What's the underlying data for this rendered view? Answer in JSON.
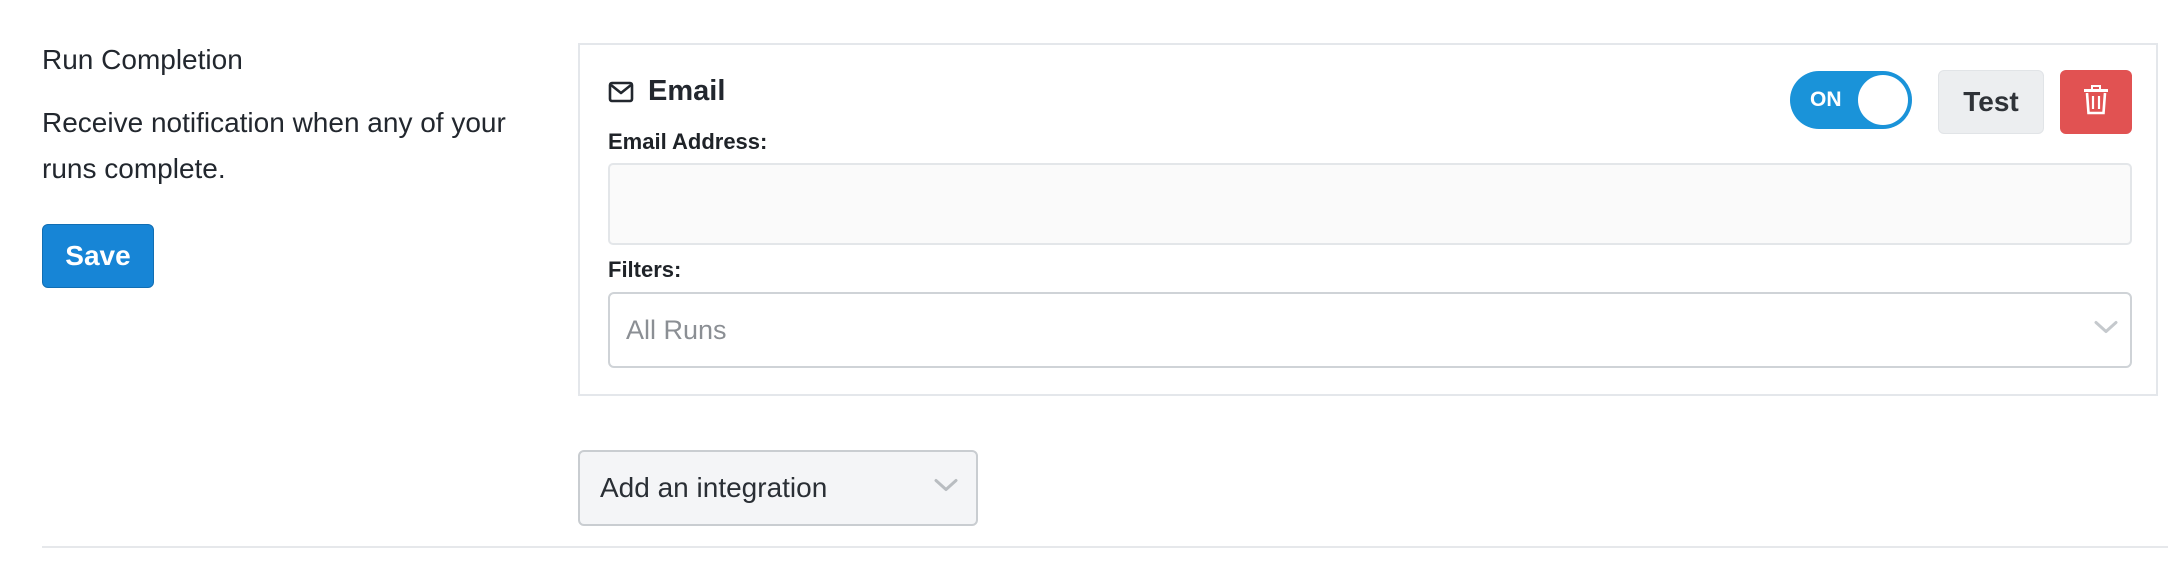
{
  "section": {
    "title": "Run Completion",
    "description": "Receive notification when any of your runs complete.",
    "save_label": "Save"
  },
  "integration": {
    "type_icon": "envelope-icon",
    "title": "Email",
    "toggle_label": "ON",
    "toggle_on": true,
    "test_label": "Test",
    "delete_icon": "trash-icon",
    "email_label": "Email Address:",
    "email_value": "",
    "filters_label": "Filters:",
    "filters_selected": "All Runs"
  },
  "add_integration": {
    "label": "Add an integration"
  },
  "colors": {
    "primary": "#1785d6",
    "toggle": "#1a93d9",
    "danger": "#e15252"
  }
}
